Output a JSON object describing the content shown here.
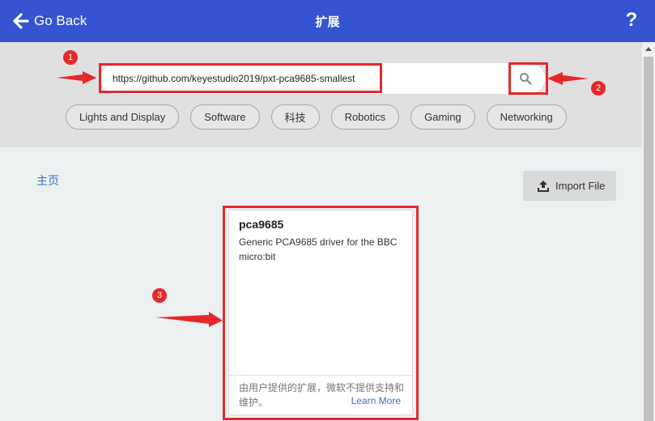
{
  "header": {
    "back_label": "Go Back",
    "title": "扩展",
    "help_label": "?"
  },
  "search": {
    "value": "https://github.com/keyestudio2019/pxt-pca9685-smallest"
  },
  "categories": [
    "Lights and Display",
    "Software",
    "科技",
    "Robotics",
    "Gaming",
    "Networking"
  ],
  "breadcrumb": {
    "home": "主页"
  },
  "import_button": {
    "label": "Import File"
  },
  "extension_card": {
    "name": "pca9685",
    "description": "Generic PCA9685 driver for the BBC micro:bit",
    "disclaimer": "由用户提供的扩展，微软不提供支持和维护。",
    "learn_more": "Learn More"
  },
  "annotations": [
    "1",
    "2",
    "3"
  ],
  "colors": {
    "header": "#3454d1",
    "annotation": "#e5282b",
    "link": "#3a6fbf"
  },
  "icons": [
    "arrow-left-icon",
    "help-icon",
    "search-icon",
    "upload-icon"
  ]
}
